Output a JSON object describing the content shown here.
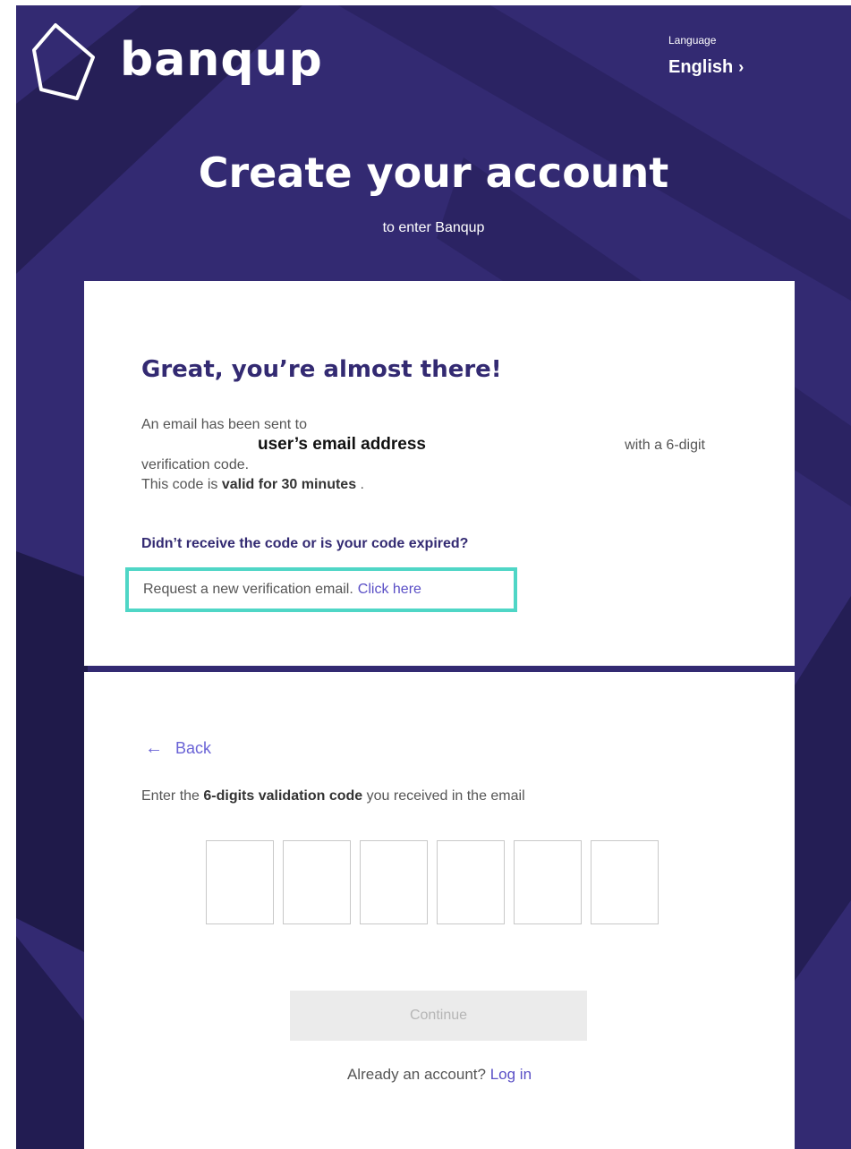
{
  "brand": {
    "name": "banqup",
    "logo_icon": "hexagon-outline-icon"
  },
  "language": {
    "label": "Language",
    "value": "English",
    "chevron": "›"
  },
  "header": {
    "title": "Create your account",
    "subtitle": "to enter Banqup"
  },
  "confirmation": {
    "heading": "Great, you’re almost there!",
    "sent_prefix": "An email has been sent to",
    "email": "user’s email address",
    "sent_suffix": "with a 6-digit",
    "sent_line2": "verification code.",
    "valid_prefix": "This code is",
    "valid_bold": "valid for 30 minutes",
    "valid_suffix": ".",
    "question": "Didn’t receive the code or is your code expired?",
    "request_text": "Request a new verification email.",
    "request_link": "Click here"
  },
  "verify": {
    "back_label": "Back",
    "instruction_prefix": "Enter the",
    "instruction_bold": "6-digits validation code",
    "instruction_suffix": "you received in the email",
    "code_digits": [
      "",
      "",
      "",
      "",
      "",
      ""
    ],
    "continue_label": "Continue",
    "account_prompt": "Already an account?",
    "login_link": "Log in"
  },
  "colors": {
    "background": "#332a72",
    "accent_link": "#5a4fc6",
    "highlight_box": "#4fd6c6",
    "disabled_button": "#ebebeb"
  }
}
